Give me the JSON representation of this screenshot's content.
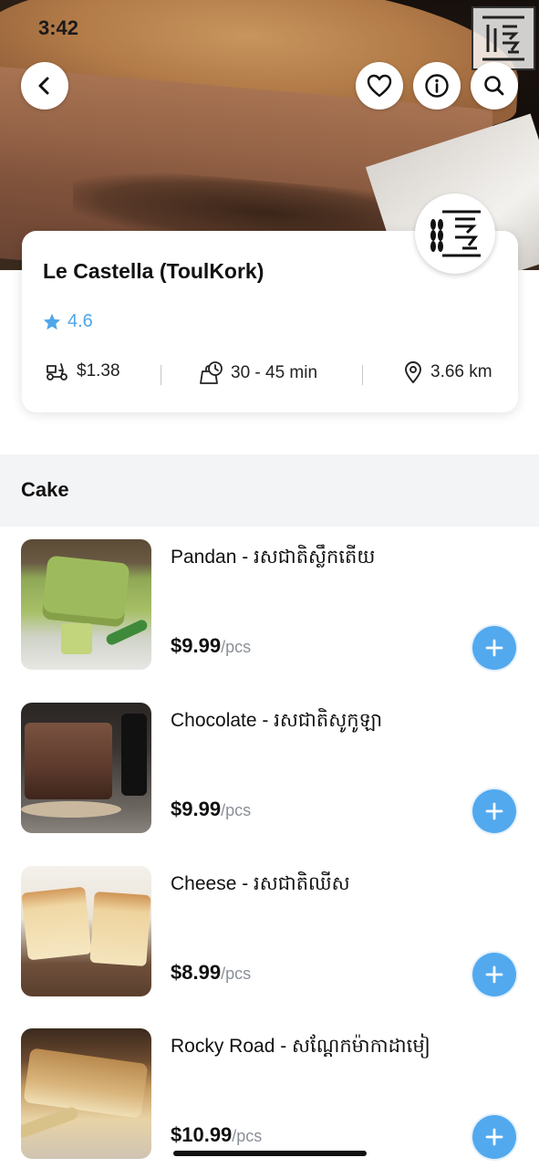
{
  "status": {
    "time": "3:42"
  },
  "header": {
    "back_icon": "chevron-left-icon",
    "favorite_icon": "heart-icon",
    "info_icon": "info-icon",
    "search_icon": "search-icon"
  },
  "store": {
    "name": "Le Castella (ToulKork)",
    "rating": "4.6",
    "delivery_fee": "$1.38",
    "delivery_time": "30 - 45 min",
    "distance": "3.66 km"
  },
  "colors": {
    "accent": "#53a9ee",
    "rating": "#4fa6e8",
    "section_bg": "#f3f4f6"
  },
  "section": {
    "title": "Cake"
  },
  "items": [
    {
      "name": "Pandan - រសជាតិស្លឹកតើយ",
      "price": "$9.99",
      "unit": "/pcs"
    },
    {
      "name": "Chocolate - រសជាតិសូកូឡា",
      "price": "$9.99",
      "unit": "/pcs"
    },
    {
      "name": "Cheese - រសជាតិឈីស",
      "price": "$8.99",
      "unit": "/pcs"
    },
    {
      "name": "Rocky Road - សណ្តែកម៉ាកាដាមៀ",
      "price": "$10.99",
      "unit": "/pcs"
    }
  ]
}
